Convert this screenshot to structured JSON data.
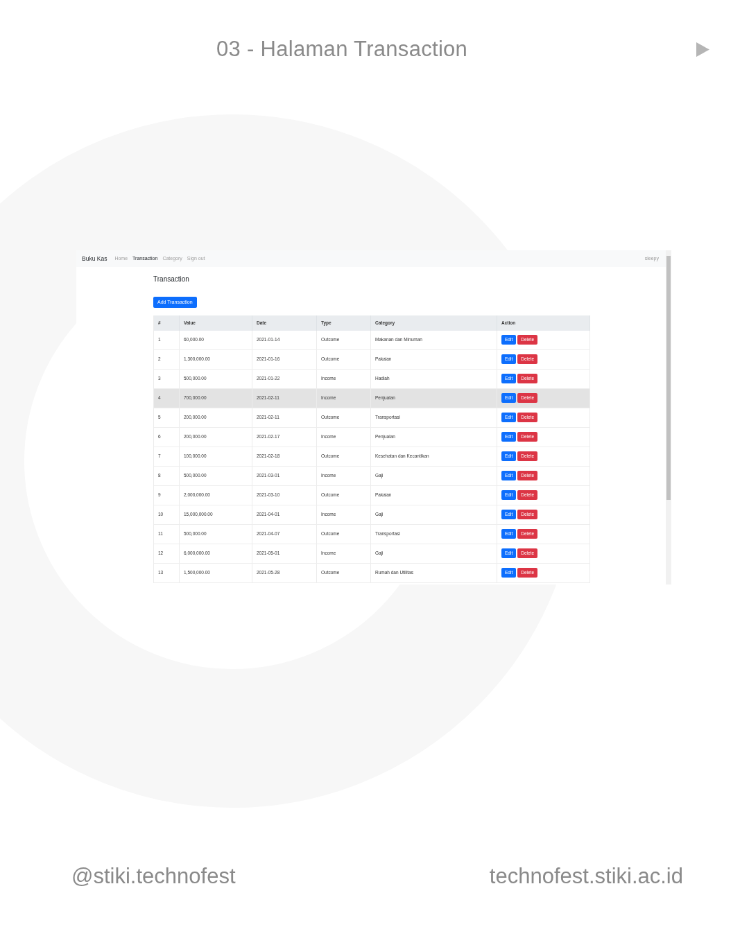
{
  "poster": {
    "title": "03 - Halaman Transaction",
    "footer_left": "@stiki.technofest",
    "footer_right": "technofest.stiki.ac.id"
  },
  "navbar": {
    "brand": "Buku Kas",
    "links": [
      {
        "label": "Home",
        "active": false
      },
      {
        "label": "Transaction",
        "active": true
      },
      {
        "label": "Category",
        "active": false
      },
      {
        "label": "Sign out",
        "active": false
      }
    ],
    "user": "sleepy"
  },
  "page": {
    "heading": "Transaction",
    "add_button": "Add Transaction"
  },
  "table": {
    "columns": [
      "#",
      "Value",
      "Date",
      "Type",
      "Category",
      "Action"
    ],
    "rows": [
      {
        "cells": [
          "1",
          "60,000.00",
          "2021-01-14",
          "Outcome",
          "Makanan dan Minuman"
        ],
        "highlighted": false,
        "actions": [
          {
            "label": "Edit",
            "kind": "edit"
          },
          {
            "label": "Delete",
            "kind": "delete"
          }
        ]
      },
      {
        "cells": [
          "2",
          "1,300,000.00",
          "2021-01-16",
          "Outcome",
          "Pakaian"
        ],
        "highlighted": false,
        "actions": [
          {
            "label": "Edit",
            "kind": "edit"
          },
          {
            "label": "Delete",
            "kind": "delete"
          }
        ]
      },
      {
        "cells": [
          "3",
          "500,000.00",
          "2021-01-22",
          "Income",
          "Hadiah"
        ],
        "highlighted": false,
        "actions": [
          {
            "label": "Edit",
            "kind": "edit"
          },
          {
            "label": "Delete",
            "kind": "delete"
          }
        ]
      },
      {
        "cells": [
          "4",
          "700,000.00",
          "2021-02-11",
          "Income",
          "Penjualan"
        ],
        "highlighted": true,
        "actions": [
          {
            "label": "Edit",
            "kind": "edit"
          },
          {
            "label": "Delete",
            "kind": "delete"
          }
        ]
      },
      {
        "cells": [
          "5",
          "200,000.00",
          "2021-02-11",
          "Outcome",
          "Transportasi"
        ],
        "highlighted": false,
        "actions": [
          {
            "label": "Edit",
            "kind": "edit"
          },
          {
            "label": "Delete",
            "kind": "delete"
          }
        ]
      },
      {
        "cells": [
          "6",
          "200,000.00",
          "2021-02-17",
          "Income",
          "Penjualan"
        ],
        "highlighted": false,
        "actions": [
          {
            "label": "Edit",
            "kind": "edit"
          },
          {
            "label": "Delete",
            "kind": "delete"
          }
        ]
      },
      {
        "cells": [
          "7",
          "100,000.00",
          "2021-02-18",
          "Outcome",
          "Kesehatan dan Kecantikan"
        ],
        "highlighted": false,
        "actions": [
          {
            "label": "Edit",
            "kind": "edit"
          },
          {
            "label": "Delete",
            "kind": "delete"
          }
        ]
      },
      {
        "cells": [
          "8",
          "500,000.00",
          "2021-03-01",
          "Income",
          "Gaji"
        ],
        "highlighted": false,
        "actions": [
          {
            "label": "Edit",
            "kind": "edit"
          },
          {
            "label": "Delete",
            "kind": "delete"
          }
        ]
      },
      {
        "cells": [
          "9",
          "2,000,000.00",
          "2021-03-10",
          "Outcome",
          "Pakaian"
        ],
        "highlighted": false,
        "actions": [
          {
            "label": "Edit",
            "kind": "edit"
          },
          {
            "label": "Delete",
            "kind": "delete"
          }
        ]
      },
      {
        "cells": [
          "10",
          "15,000,000.00",
          "2021-04-01",
          "Income",
          "Gaji"
        ],
        "highlighted": false,
        "actions": [
          {
            "label": "Edit",
            "kind": "edit"
          },
          {
            "label": "Delete",
            "kind": "delete"
          }
        ]
      },
      {
        "cells": [
          "11",
          "500,000.00",
          "2021-04-07",
          "Outcome",
          "Transportasi"
        ],
        "highlighted": false,
        "actions": [
          {
            "label": "Edit",
            "kind": "edit"
          },
          {
            "label": "Delete",
            "kind": "delete"
          }
        ]
      },
      {
        "cells": [
          "12",
          "6,000,000.00",
          "2021-05-01",
          "Income",
          "Gaji"
        ],
        "highlighted": false,
        "actions": [
          {
            "label": "Edit",
            "kind": "edit"
          },
          {
            "label": "Delete",
            "kind": "delete"
          }
        ]
      },
      {
        "cells": [
          "13",
          "1,500,000.00",
          "2021-05-28",
          "Outcome",
          "Rumah dan Utilitas"
        ],
        "highlighted": false,
        "actions": [
          {
            "label": "Edit",
            "kind": "edit"
          },
          {
            "label": "Delete",
            "kind": "delete"
          }
        ]
      }
    ]
  }
}
